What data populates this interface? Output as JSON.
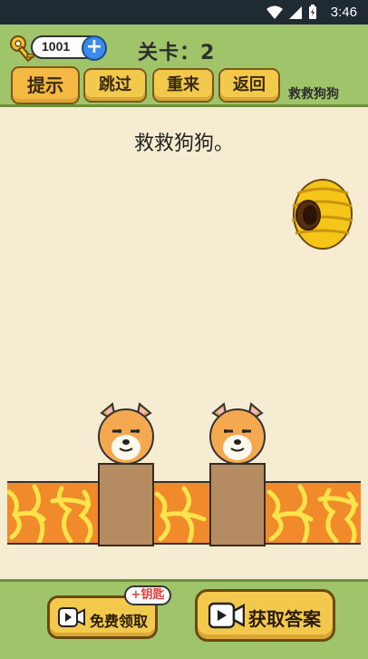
{
  "status_bar": {
    "time": "3:46",
    "icons": [
      "wifi-icon",
      "signal-icon",
      "battery-icon"
    ]
  },
  "header": {
    "coins": "1001",
    "level_label": "关卡：2",
    "level_name": "救救狗狗"
  },
  "toolbar": {
    "hint": "提示",
    "skip": "跳过",
    "restart": "重来",
    "back": "返回"
  },
  "stage": {
    "prompt": "救救狗狗。",
    "objects": [
      "beehive",
      "dog",
      "dog",
      "pillar",
      "pillar",
      "lava"
    ]
  },
  "bottom": {
    "free_claim": "免费领取",
    "key_badge": "+钥匙",
    "get_answer": "获取答案"
  },
  "colors": {
    "background": "#f6ecd2",
    "panel": "#9fc46a",
    "button": "#f2c94c",
    "lava": "#f08a2b",
    "pillar": "#b58b61"
  }
}
